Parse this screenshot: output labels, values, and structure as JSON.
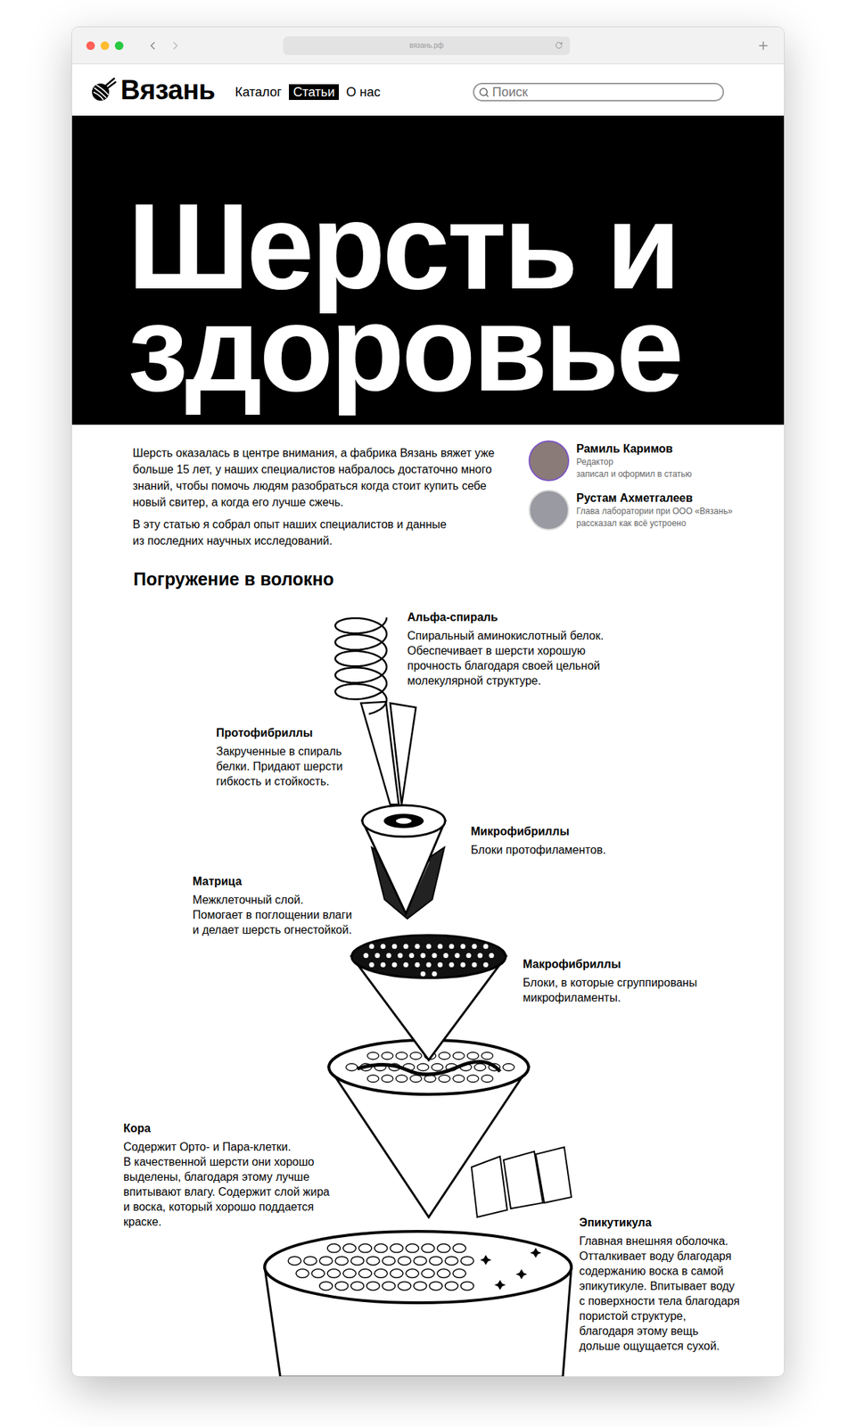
{
  "browser": {
    "url": "вязань.рф"
  },
  "header": {
    "logo": "Вязань",
    "nav": [
      {
        "label": "Каталог",
        "selected": false
      },
      {
        "label": "Статьи",
        "selected": true
      },
      {
        "label": "О нас",
        "selected": false
      }
    ],
    "search": {
      "placeholder": "Поиск"
    }
  },
  "hero": {
    "title_lines": [
      "Шерсть и",
      "здоровье"
    ]
  },
  "intro": {
    "paragraphs": [
      [
        "Шерсть оказалась в центре внимания, а фабрика Вязань вяжет уже",
        "больше 15 лет, у наших специалистов набралось достаточно много",
        "знаний, чтобы помочь людям разобраться когда стоит купить себе",
        "новый свитер, а когда его лучше сжечь."
      ],
      [
        "В эту статью я собрал опыт наших специалистов и данные",
        "из последних научных исследований."
      ]
    ]
  },
  "authors": [
    {
      "name": "Рамиль Каримов",
      "role": "Редактор",
      "note": "записал и оформил в статью"
    },
    {
      "name": "Рустам Ахметгалеев",
      "role": "Глава лаборатории при ООО «Вязань»",
      "note": "рассказал как всё устроено"
    }
  ],
  "section": {
    "title": "Погружение в волокно",
    "labels": [
      {
        "title": "Альфа-спираль",
        "lines": [
          "Спиральный аминокислотный белок.",
          "Обеспечивает в шерсти хорошую",
          "прочность благодаря своей цельной",
          "молекулярной структуре."
        ]
      },
      {
        "title": "Протофибриллы",
        "lines": [
          "Закрученные в спираль",
          "белки. Придают шерсти",
          "гибкость и стойкость."
        ]
      },
      {
        "title": "Микрофибриллы",
        "lines": [
          "Блоки протофиламентов."
        ]
      },
      {
        "title": "Матрица",
        "lines": [
          "Межклеточный слой.",
          "Помогает в поглощении влаги",
          "и делает шерсть огнестойкой."
        ]
      },
      {
        "title": "Макрофибриллы",
        "lines": [
          "Блоки, в которые сгруппированы",
          "микрофиламенты."
        ]
      },
      {
        "title": "Кора",
        "lines": [
          "Содержит Орто- и Пара-клетки.",
          "В качественной шерсти они хорошо",
          "выделены, благодаря этому лучше",
          "впитывают влагу. Содержит слой жира",
          "и воска, который хорошо поддается",
          "краске."
        ]
      },
      {
        "title": "Эпикутикула",
        "lines": [
          "Главная внешняя оболочка.",
          "Отталкивает воду благодаря",
          "содержанию воска в самой",
          "эпикутикуле. Впитывает воду",
          "с поверхности тела благодаря",
          "пористой структуре,",
          "благодаря этому вещь",
          "дольше ощущается сухой."
        ]
      }
    ]
  }
}
